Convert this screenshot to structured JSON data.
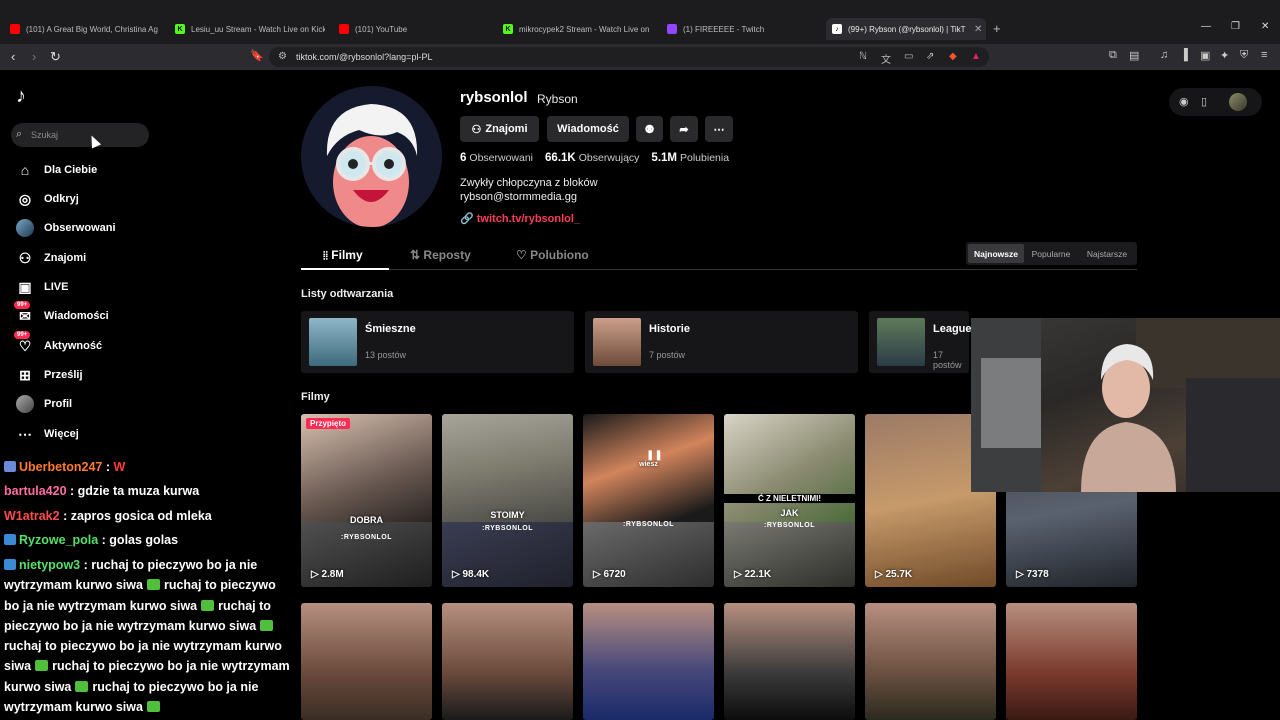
{
  "browser": {
    "tabs": [
      {
        "title": "(101) A Great Big World, Christina Ag",
        "color": "#ff0000"
      },
      {
        "title": "Lesiu_uu Stream - Watch Live on Kick",
        "color": "#53fc18"
      },
      {
        "title": "(101) YouTube",
        "color": "#ff0000"
      },
      {
        "title": "mikrocypek2 Stream - Watch Live on",
        "color": "#53fc18"
      },
      {
        "title": "(1) FIREEEEE - Twitch",
        "color": "#9146ff"
      },
      {
        "title": "(99+) Rybson (@rybsonlol) | TikT",
        "color": "#ffffff"
      }
    ],
    "url": "tiktok.com/@rybsonlol?lang=pl-PL"
  },
  "sidebar": {
    "search_placeholder": "Szukaj",
    "items": [
      {
        "label": "Dla Ciebie",
        "icon": "home-icon"
      },
      {
        "label": "Odkryj",
        "icon": "compass-icon"
      },
      {
        "label": "Obserwowani",
        "icon": "following-avatar-icon"
      },
      {
        "label": "Znajomi",
        "icon": "friends-icon"
      },
      {
        "label": "LIVE",
        "icon": "live-icon"
      },
      {
        "label": "Wiadomości",
        "icon": "messages-icon",
        "badge": "99+"
      },
      {
        "label": "Aktywność",
        "icon": "activity-icon",
        "badge": "99+"
      },
      {
        "label": "Prześlij",
        "icon": "upload-icon"
      },
      {
        "label": "Profil",
        "icon": "profile-avatar-icon"
      },
      {
        "label": "Więcej",
        "icon": "more-icon"
      }
    ]
  },
  "chat": {
    "lines": [
      {
        "user": "Uberbeton247",
        "text": "W",
        "color": "#ff7b2e"
      },
      {
        "user": "bartula420",
        "text": "gdzie ta muza kurwa",
        "color": "#ff6ea5"
      },
      {
        "user": "W1atrak2",
        "text": "zapros gosica od mleka",
        "color": "#ff4b4b"
      },
      {
        "user": "Ryzowe_pola",
        "text": "golas golas",
        "color": "#55e06a"
      },
      {
        "user": "nietypow3",
        "text": "ruchaj to pieczywo bo ja nie wytrzymam kurwo siwa",
        "color": "#55e06a"
      }
    ],
    "spam_segments": [
      "ruchaj to pieczywo bo ja nie wytrzymam kurwo siwa",
      "ruchaj to pieczywo bo ja nie wytrzymam kurwo siwa",
      "ruchaj to pieczywo bo ja nie wytrzymam kurwo siwa",
      "ruchaj to pieczywo bo ja nie wytrzymam kurwo siwa",
      "ruchaj to pieczywo bo ja nie wytrzymam kurwo siwa"
    ]
  },
  "profile": {
    "handle": "rybsonlol",
    "nickname": "Rybson",
    "buttons": {
      "friends": "Znajomi",
      "message": "Wiadomość"
    },
    "stats": {
      "following_count": "6",
      "following_label": "Obserwowani",
      "followers_count": "66.1K",
      "followers_label": "Obserwujący",
      "likes_count": "5.1M",
      "likes_label": "Polubienia"
    },
    "bio_line1": "Zwykły chłopczyna z bloków",
    "bio_line2": "rybson@stormmedia.gg",
    "link": "twitch.tv/rybsonlol_"
  },
  "tabs": {
    "videos": "Filmy",
    "reposts": "Reposty",
    "liked": "Polubiono"
  },
  "sort": {
    "newest": "Najnowsze",
    "popular": "Popularne",
    "oldest": "Najstarsze"
  },
  "playlists_title": "Listy odtwarzania",
  "playlists": [
    {
      "name": "Śmieszne",
      "count": "13 postów"
    },
    {
      "name": "Historie",
      "count": "7 postów"
    },
    {
      "name": "League",
      "count": "17 postów"
    }
  ],
  "videos_title": "Filmy",
  "videos": [
    {
      "views": "2.8M",
      "pinned": "Przypięto",
      "caption": "DOBRA",
      "watermark": ":RYBSONLOL"
    },
    {
      "views": "98.4K",
      "caption": "STOIMY",
      "watermark": ":RYBSONLOL"
    },
    {
      "views": "6720",
      "caption": "wiesz",
      "watermark": ":RYBSONLOL"
    },
    {
      "views": "22.1K",
      "caption": "JAK",
      "caption_top": "Ć Z NIELETNIMI!",
      "watermark": ":RYBSONLOL"
    },
    {
      "views": "25.7K"
    },
    {
      "views": "7378"
    }
  ]
}
